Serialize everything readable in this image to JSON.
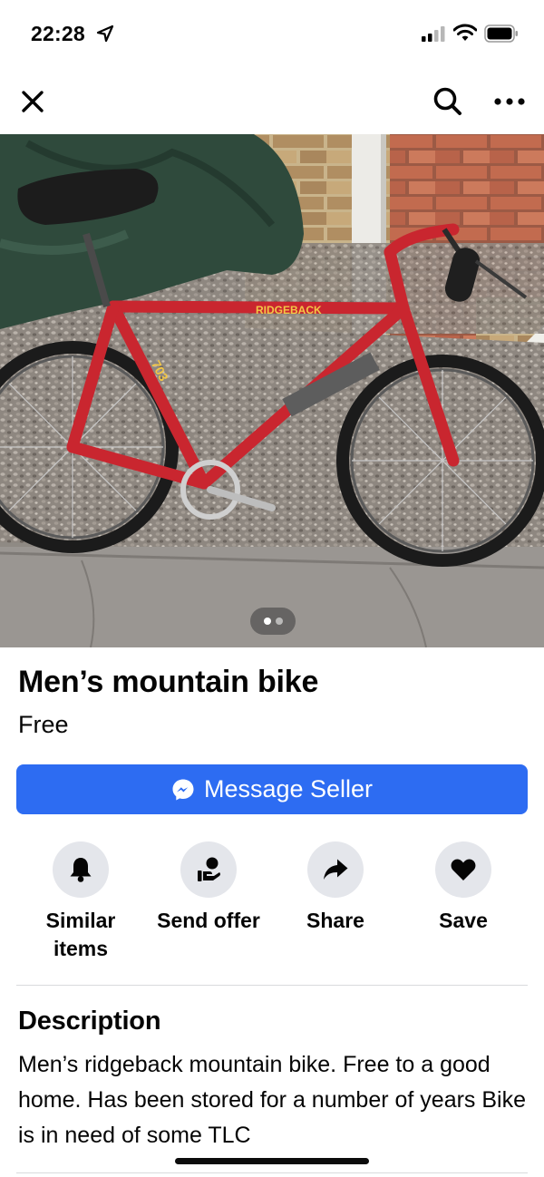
{
  "status_bar": {
    "time": "22:28",
    "icons": [
      "location-arrow-icon",
      "cellular-signal-icon",
      "wifi-icon",
      "battery-icon"
    ]
  },
  "nav": {
    "icons": [
      "close-icon",
      "search-icon",
      "more-icon"
    ]
  },
  "photo": {
    "icon": "bike-photo",
    "brand_text": "RIDGEBACK",
    "model_text": "703",
    "image_count": 2,
    "active_index": 0
  },
  "listing": {
    "title": "Men’s mountain bike",
    "price": "Free"
  },
  "message_button": {
    "label": "Message Seller",
    "icon": "messenger-icon",
    "color": "#2d6cf2"
  },
  "actions": [
    {
      "label": "Similar items",
      "icon": "bell-icon"
    },
    {
      "label": "Send offer",
      "icon": "send-offer-icon"
    },
    {
      "label": "Share",
      "icon": "share-icon"
    },
    {
      "label": "Save",
      "icon": "heart-icon"
    }
  ],
  "description": {
    "heading": "Description",
    "text": "Men’s ridgeback mountain bike. Free to a good home. Has been stored for a number of years   Bike is in need of some TLC"
  },
  "colors": {
    "accent": "#2d6cf2",
    "action_bg": "#e4e6eb",
    "text": "#050505"
  }
}
